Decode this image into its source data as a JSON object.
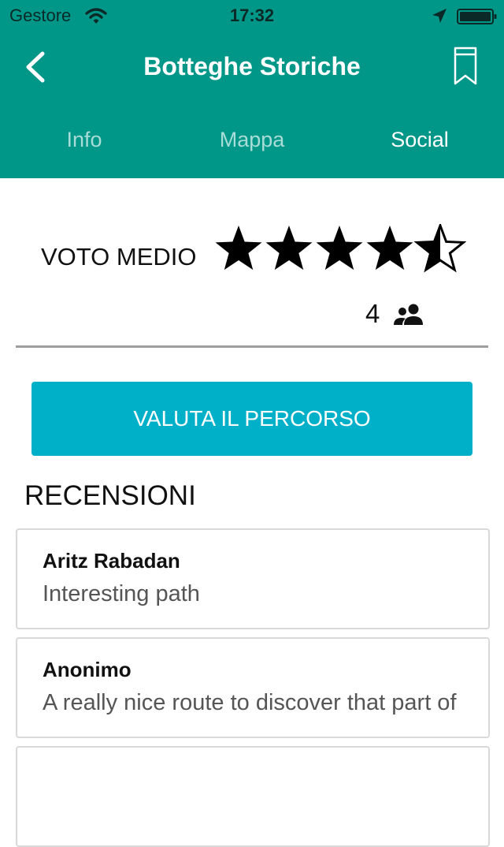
{
  "status_bar": {
    "carrier": "Gestore",
    "time": "17:32"
  },
  "header": {
    "title": "Botteghe Storiche",
    "back_icon": "chevron-left-icon",
    "bookmark_icon": "bookmark-icon",
    "color": "#009688"
  },
  "tabs": [
    {
      "label": "Info",
      "active": false
    },
    {
      "label": "Mappa",
      "active": false
    },
    {
      "label": "Social",
      "active": true
    }
  ],
  "rating": {
    "label": "VOTO MEDIO",
    "value": 4.5,
    "max": 5,
    "votes": "4",
    "votes_icon": "people-icon"
  },
  "rate_button": {
    "label": "VALUTA IL PERCORSO",
    "color": "#00b0c8"
  },
  "reviews": {
    "heading": "RECENSIONI",
    "items": [
      {
        "author": "Aritz Rabadan",
        "text": "Interesting path"
      },
      {
        "author": "Anonimo",
        "text": "A really nice route to discover that part of"
      }
    ]
  }
}
